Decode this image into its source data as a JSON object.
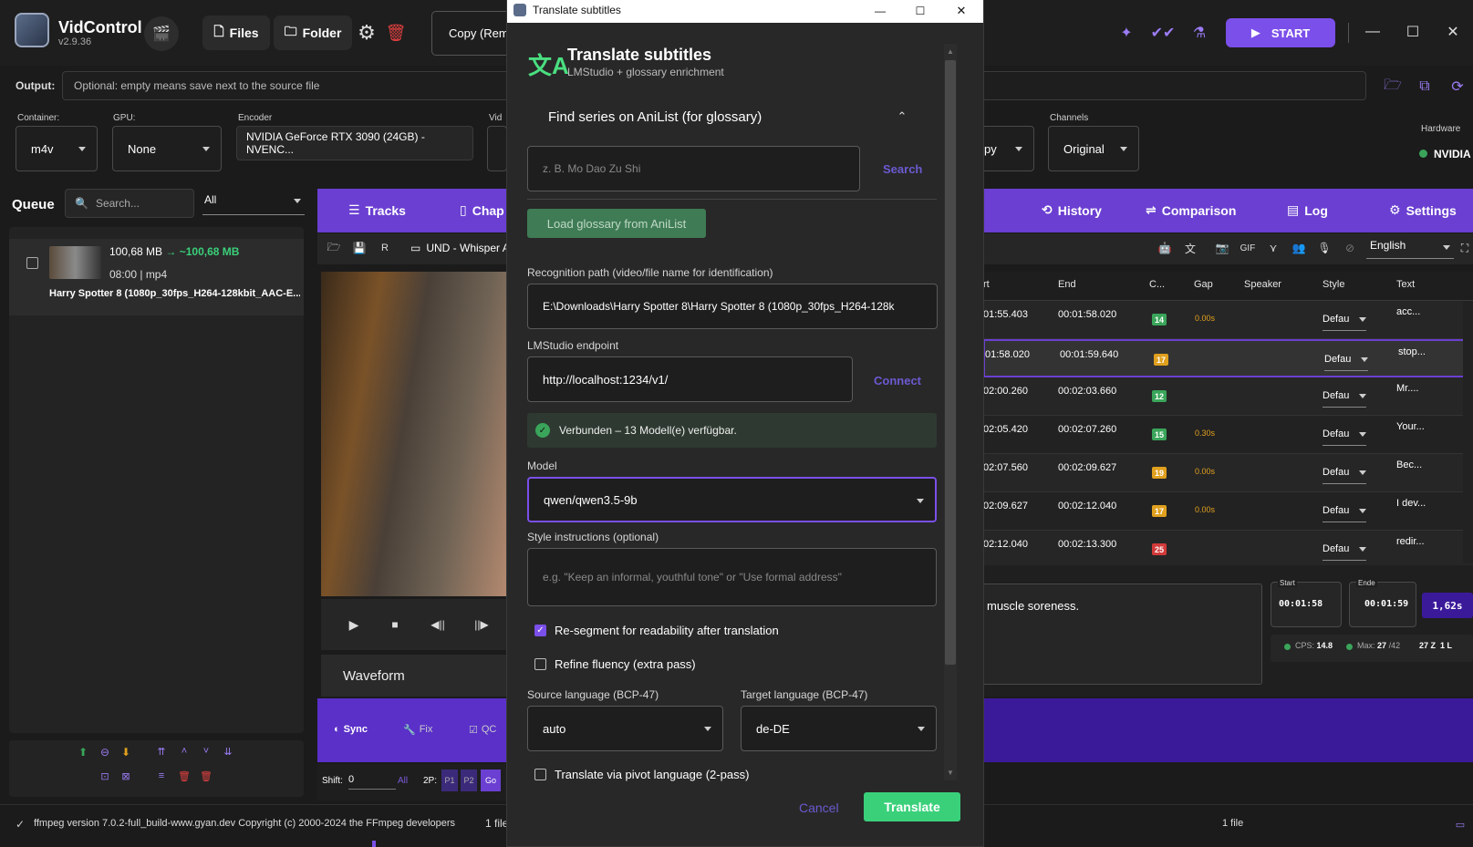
{
  "app": {
    "name": "VidControl",
    "version": "v2.9.36"
  },
  "toolbar": {
    "files": "Files",
    "folder": "Folder",
    "copy": "Copy (Rem",
    "start": "START"
  },
  "output": {
    "label": "Output:",
    "placeholder": "Optional: empty means save next to the source file"
  },
  "settings": {
    "container_label": "Container:",
    "container": "m4v",
    "gpu_label": "GPU:",
    "gpu": "None",
    "encoder_label": "Encoder",
    "encoder": "NVIDIA GeForce RTX 3090 (24GB) - NVENC...",
    "video_label": "Vid",
    "audio_partial": "py",
    "channels_label": "Channels",
    "channels": "Original",
    "hardware_label": "Hardware",
    "hardware": "NVIDIA"
  },
  "queue": {
    "title": "Queue",
    "search_placeholder": "Search...",
    "filter": "All",
    "item": {
      "size": "100,68 MB",
      "arrow": "→",
      "target": "~100,68 MB",
      "meta": "08:00 | mp4",
      "name": "Harry Spotter 8 (1080p_30fps_H264-128kbit_AAC-E..."
    }
  },
  "tabs": {
    "tracks": "Tracks",
    "chap": "Chap",
    "history": "History",
    "comparison": "Comparison",
    "log": "Log",
    "settings": "Settings"
  },
  "subtoolbar": {
    "track": "UND - Whisper A",
    "language": "English"
  },
  "table": {
    "headers": [
      "rt",
      "End",
      "C...",
      "Gap",
      "Speaker",
      "Style",
      "Text"
    ],
    "rows": [
      {
        "start": "01:55.403",
        "end": "00:01:58.020",
        "cps": "14",
        "cps_color": "#3aa55a",
        "gap": "0.00s",
        "style": "Defau",
        "text": "acc..."
      },
      {
        "start": "01:58.020",
        "end": "00:01:59.640",
        "cps": "17",
        "cps_color": "#e0a01e",
        "gap": "",
        "style": "Defau",
        "text": "stop..."
      },
      {
        "start": "02:00.260",
        "end": "00:02:03.660",
        "cps": "12",
        "cps_color": "#3aa55a",
        "gap": "",
        "style": "Defau",
        "text": "Mr...."
      },
      {
        "start": "02:05.420",
        "end": "00:02:07.260",
        "cps": "15",
        "cps_color": "#3aa55a",
        "gap": "0.30s",
        "style": "Defau",
        "text": "Your..."
      },
      {
        "start": "02:07.560",
        "end": "00:02:09.627",
        "cps": "19",
        "cps_color": "#e0a01e",
        "gap": "0.00s",
        "style": "Defau",
        "text": "Bec..."
      },
      {
        "start": "02:09.627",
        "end": "00:02:12.040",
        "cps": "17",
        "cps_color": "#e0a01e",
        "gap": "0.00s",
        "style": "Defau",
        "text": "I dev..."
      },
      {
        "start": "02:12.040",
        "end": "00:02:13.300",
        "cps": "25",
        "cps_color": "#d23a3a",
        "gap": "",
        "style": "Defau",
        "text": "redir..."
      }
    ]
  },
  "editor": {
    "text": "muscle soreness.",
    "start_label": "Start",
    "start": "00:01:58",
    "end_label": "Ende",
    "end": "00:01:59",
    "duration": "1,62s",
    "cps_label": "CPS:",
    "cps": "14.8",
    "max_label": "Max:",
    "max": "27",
    "max_total": "/42",
    "z": "27 Z",
    "l": "1 L"
  },
  "player": {
    "waveform": "Waveform"
  },
  "bottombar": {
    "sync": "Sync",
    "fix": "Fix",
    "qc": "QC",
    "shift_label": "Shift:",
    "shift": "0",
    "all": "All",
    "twop": "2P:",
    "p1": "P1",
    "p2": "P2",
    "go": "Go"
  },
  "status": {
    "ffmpeg": "ffmpeg version 7.0.2-full_build-www.gyan.dev Copyright (c) 2000-2024 the FFmpeg developers",
    "files_left": "1 file(",
    "files": "1 file"
  },
  "dialog": {
    "window_title": "Translate subtitles",
    "title": "Translate subtitles",
    "subtitle": "LMStudio + glossary enrichment",
    "anilist_section": "Find series on AniList (for glossary)",
    "anilist_placeholder": "z. B. Mo Dao Zu Shi",
    "search": "Search",
    "load_glossary": "Load glossary from AniList",
    "path_label": "Recognition path (video/file name for identification)",
    "path": "E:\\Downloads\\Harry Spotter 8\\Harry Spotter 8 (1080p_30fps_H264-128k",
    "endpoint_label": "LMStudio endpoint",
    "endpoint": "http://localhost:1234/v1/",
    "connect": "Connect",
    "status": "Verbunden – 13 Modell(e) verfügbar.",
    "model_label": "Model",
    "model": "qwen/qwen3.5-9b",
    "style_label": "Style instructions (optional)",
    "style_placeholder": "e.g. \"Keep an informal, youthful tone\" or \"Use formal address\"",
    "resegment": "Re-segment for readability after translation",
    "refine": "Refine fluency (extra pass)",
    "source_label": "Source language (BCP-47)",
    "source": "auto",
    "target_label": "Target language (BCP-47)",
    "target": "de-DE",
    "pivot": "Translate via pivot language (2-pass)",
    "cancel": "Cancel",
    "translate": "Translate"
  }
}
